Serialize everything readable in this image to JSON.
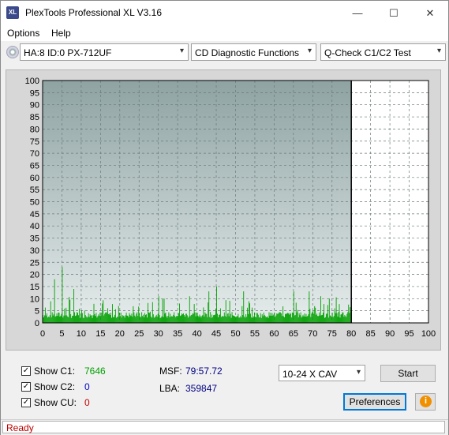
{
  "window": {
    "title": "PlexTools Professional XL V3.16",
    "icon_text": "XL",
    "controls": {
      "minimize": "—",
      "maximize": "☐",
      "close": "✕"
    }
  },
  "menu": {
    "options": "Options",
    "help": "Help"
  },
  "toolbar": {
    "drive": "HA:8 ID:0  PX-712UF",
    "function": "CD Diagnostic Functions",
    "test": "Q-Check C1/C2 Test",
    "dropdown_arrow": "▾"
  },
  "chart_data": {
    "type": "bar",
    "x_ticks": [
      "0",
      "5",
      "10",
      "15",
      "20",
      "25",
      "30",
      "35",
      "40",
      "45",
      "50",
      "55",
      "60",
      "65",
      "70",
      "75",
      "80",
      "85",
      "90",
      "95",
      "100"
    ],
    "y_ticks": [
      "0",
      "5",
      "10",
      "15",
      "20",
      "25",
      "30",
      "35",
      "40",
      "45",
      "50",
      "55",
      "60",
      "65",
      "70",
      "75",
      "80",
      "85",
      "90",
      "95",
      "100"
    ],
    "xlim": [
      0,
      100
    ],
    "ylim": [
      0,
      100
    ],
    "grid": true,
    "completed_up_to_x": 80,
    "series": [
      {
        "color": "#00a000",
        "notable_peaks": [
          [
            5,
            23
          ],
          [
            3,
            18
          ],
          [
            8,
            14
          ],
          [
            45,
            15
          ],
          [
            43,
            13
          ],
          [
            38,
            11
          ],
          [
            52,
            13
          ],
          [
            69,
            13
          ],
          [
            65,
            13
          ],
          [
            72,
            11
          ],
          [
            30,
            11
          ]
        ]
      }
    ],
    "baseline_level": 2,
    "colors": {
      "plot_top": "#8fa3a3",
      "plot_bottom": "#e6ecec",
      "unscanned": "#ffffff"
    }
  },
  "controls": {
    "show_c1_label": "Show C1:",
    "show_c1_value": "7646",
    "show_c2_label": "Show C2:",
    "show_c2_value": "0",
    "show_cu_label": "Show CU:",
    "show_cu_value": "0",
    "checkmark": "✓",
    "msf_label": "MSF:",
    "msf_value": "79:57.72",
    "lba_label": "LBA:",
    "lba_value": "359847",
    "speed": "10-24 X CAV",
    "start_button": "Start",
    "preferences_button": "Preferences",
    "info_icon": "i"
  },
  "status": {
    "text": "Ready"
  }
}
